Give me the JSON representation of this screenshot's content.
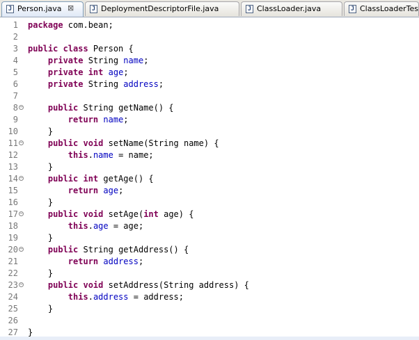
{
  "tabs": [
    {
      "label": "Person.java",
      "active": true,
      "close": "⊠"
    },
    {
      "label": "DeploymentDescriptorFile.java",
      "active": false
    },
    {
      "label": "ClassLoader.java",
      "active": false
    },
    {
      "label": "ClassLoaderTes",
      "active": false
    }
  ],
  "icons": {
    "java_file_icon": "J",
    "fold_icon": "−"
  },
  "colors": {
    "keyword": "#7f0055",
    "field": "#0000c0",
    "line_number": "#787878",
    "active_tab": "#dfe8f6"
  },
  "code": {
    "lines": [
      {
        "n": "1",
        "fold": false,
        "segs": [
          {
            "k": "kw",
            "t": "package"
          },
          {
            "k": "t",
            "t": " com.bean;"
          }
        ]
      },
      {
        "n": "2",
        "fold": false,
        "segs": []
      },
      {
        "n": "3",
        "fold": false,
        "segs": [
          {
            "k": "kw",
            "t": "public class"
          },
          {
            "k": "t",
            "t": " Person {"
          }
        ]
      },
      {
        "n": "4",
        "fold": false,
        "segs": [
          {
            "k": "t",
            "t": "    "
          },
          {
            "k": "kw",
            "t": "private"
          },
          {
            "k": "t",
            "t": " String "
          },
          {
            "k": "fld",
            "t": "name"
          },
          {
            "k": "t",
            "t": ";"
          }
        ]
      },
      {
        "n": "5",
        "fold": false,
        "segs": [
          {
            "k": "t",
            "t": "    "
          },
          {
            "k": "kw",
            "t": "private int"
          },
          {
            "k": "t",
            "t": " "
          },
          {
            "k": "fld",
            "t": "age"
          },
          {
            "k": "t",
            "t": ";"
          }
        ]
      },
      {
        "n": "6",
        "fold": false,
        "segs": [
          {
            "k": "t",
            "t": "    "
          },
          {
            "k": "kw",
            "t": "private"
          },
          {
            "k": "t",
            "t": " String "
          },
          {
            "k": "fld",
            "t": "address"
          },
          {
            "k": "t",
            "t": ";"
          }
        ]
      },
      {
        "n": "7",
        "fold": false,
        "segs": []
      },
      {
        "n": "8",
        "fold": true,
        "segs": [
          {
            "k": "t",
            "t": "    "
          },
          {
            "k": "kw",
            "t": "public"
          },
          {
            "k": "t",
            "t": " String getName() {"
          }
        ]
      },
      {
        "n": "9",
        "fold": false,
        "segs": [
          {
            "k": "t",
            "t": "        "
          },
          {
            "k": "kw",
            "t": "return"
          },
          {
            "k": "t",
            "t": " "
          },
          {
            "k": "fld",
            "t": "name"
          },
          {
            "k": "t",
            "t": ";"
          }
        ]
      },
      {
        "n": "10",
        "fold": false,
        "segs": [
          {
            "k": "t",
            "t": "    }"
          }
        ]
      },
      {
        "n": "11",
        "fold": true,
        "segs": [
          {
            "k": "t",
            "t": "    "
          },
          {
            "k": "kw",
            "t": "public void"
          },
          {
            "k": "t",
            "t": " setName(String name) {"
          }
        ]
      },
      {
        "n": "12",
        "fold": false,
        "segs": [
          {
            "k": "t",
            "t": "        "
          },
          {
            "k": "kw",
            "t": "this"
          },
          {
            "k": "t",
            "t": "."
          },
          {
            "k": "fld",
            "t": "name"
          },
          {
            "k": "t",
            "t": " = name;"
          }
        ]
      },
      {
        "n": "13",
        "fold": false,
        "segs": [
          {
            "k": "t",
            "t": "    }"
          }
        ]
      },
      {
        "n": "14",
        "fold": true,
        "segs": [
          {
            "k": "t",
            "t": "    "
          },
          {
            "k": "kw",
            "t": "public int"
          },
          {
            "k": "t",
            "t": " getAge() {"
          }
        ]
      },
      {
        "n": "15",
        "fold": false,
        "segs": [
          {
            "k": "t",
            "t": "        "
          },
          {
            "k": "kw",
            "t": "return"
          },
          {
            "k": "t",
            "t": " "
          },
          {
            "k": "fld",
            "t": "age"
          },
          {
            "k": "t",
            "t": ";"
          }
        ]
      },
      {
        "n": "16",
        "fold": false,
        "segs": [
          {
            "k": "t",
            "t": "    }"
          }
        ]
      },
      {
        "n": "17",
        "fold": true,
        "segs": [
          {
            "k": "t",
            "t": "    "
          },
          {
            "k": "kw",
            "t": "public void"
          },
          {
            "k": "t",
            "t": " setAge("
          },
          {
            "k": "kw",
            "t": "int"
          },
          {
            "k": "t",
            "t": " age) {"
          }
        ]
      },
      {
        "n": "18",
        "fold": false,
        "segs": [
          {
            "k": "t",
            "t": "        "
          },
          {
            "k": "kw",
            "t": "this"
          },
          {
            "k": "t",
            "t": "."
          },
          {
            "k": "fld",
            "t": "age"
          },
          {
            "k": "t",
            "t": " = age;"
          }
        ]
      },
      {
        "n": "19",
        "fold": false,
        "segs": [
          {
            "k": "t",
            "t": "    }"
          }
        ]
      },
      {
        "n": "20",
        "fold": true,
        "segs": [
          {
            "k": "t",
            "t": "    "
          },
          {
            "k": "kw",
            "t": "public"
          },
          {
            "k": "t",
            "t": " String getAddress() {"
          }
        ]
      },
      {
        "n": "21",
        "fold": false,
        "segs": [
          {
            "k": "t",
            "t": "        "
          },
          {
            "k": "kw",
            "t": "return"
          },
          {
            "k": "t",
            "t": " "
          },
          {
            "k": "fld",
            "t": "address"
          },
          {
            "k": "t",
            "t": ";"
          }
        ]
      },
      {
        "n": "22",
        "fold": false,
        "segs": [
          {
            "k": "t",
            "t": "    }"
          }
        ]
      },
      {
        "n": "23",
        "fold": true,
        "segs": [
          {
            "k": "t",
            "t": "    "
          },
          {
            "k": "kw",
            "t": "public void"
          },
          {
            "k": "t",
            "t": " setAddress(String address) {"
          }
        ]
      },
      {
        "n": "24",
        "fold": false,
        "segs": [
          {
            "k": "t",
            "t": "        "
          },
          {
            "k": "kw",
            "t": "this"
          },
          {
            "k": "t",
            "t": "."
          },
          {
            "k": "fld",
            "t": "address"
          },
          {
            "k": "t",
            "t": " = address;"
          }
        ]
      },
      {
        "n": "25",
        "fold": false,
        "segs": [
          {
            "k": "t",
            "t": "    }"
          }
        ]
      },
      {
        "n": "26",
        "fold": false,
        "segs": []
      },
      {
        "n": "27",
        "fold": false,
        "segs": [
          {
            "k": "t",
            "t": "}"
          }
        ]
      }
    ]
  }
}
